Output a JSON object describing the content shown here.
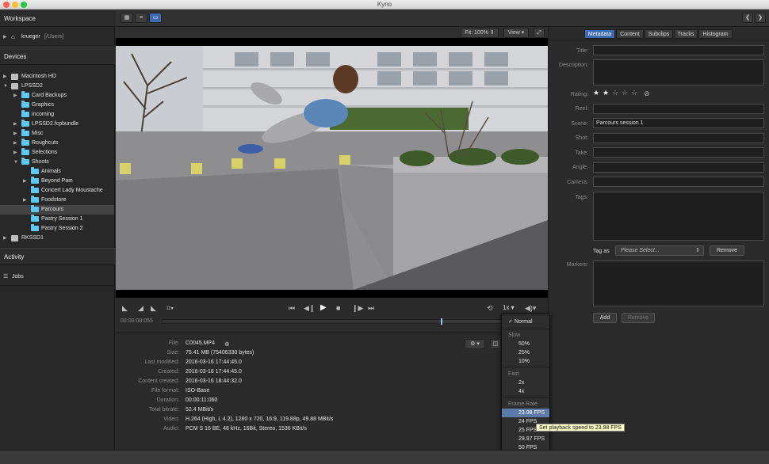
{
  "window": {
    "title": "Kyno"
  },
  "sidebar": {
    "workspace_header": "Workspace",
    "workspace_item": {
      "name": "krueger",
      "path": "[/Users]"
    },
    "devices_header": "Devices",
    "devices": [
      {
        "label": "Macintosh HD"
      },
      {
        "label": "LPSSD2"
      }
    ],
    "folders": [
      "Card Backups",
      "Graphics",
      "incoming",
      "LPSSD2.fcpbundle",
      "Misc",
      "Roughcuts",
      "Selections",
      "Shoots"
    ],
    "shoot_folders": [
      "Animals",
      "Beyond Pain",
      "Concert Lady Moustache",
      "Foodstore",
      "Parcours",
      "Pastry Session 1",
      "Pastry Session 2"
    ],
    "other_device": "RKSSD1",
    "activity_header": "Activity",
    "jobs_header": "Jobs"
  },
  "viewer": {
    "fit_label": "Fit: 100%",
    "view_label": "View",
    "timecode": "00:00:08:055",
    "speed_label": "1x",
    "progress": 0.82
  },
  "tabs": [
    "Metadata",
    "Content",
    "Subclips",
    "Tracks",
    "Histogram"
  ],
  "metadata": {
    "labels": {
      "title": "Title:",
      "description": "Description:",
      "rating": "Rating:",
      "reel": "Reel:",
      "scene": "Scene:",
      "shot": "Shot:",
      "take": "Take:",
      "angle": "Angle:",
      "camera": "Camera:",
      "tags": "Tags:",
      "markers": "Markers:"
    },
    "scene_value": "Parcours session 1",
    "rating": 2,
    "rating_max": 5,
    "tag_as_label": "Tag as",
    "tag_placeholder": "Please Select...",
    "remove_tag_label": "Remove",
    "add_marker_label": "Add",
    "remove_marker_label": "Remove"
  },
  "file_info": [
    {
      "label": "File:",
      "value": "C0045.MP4"
    },
    {
      "label": "Size:",
      "value": "75.41 MB (75406330 bytes)"
    },
    {
      "label": "Last modified:",
      "value": "2016-03-16 17:44:45.0"
    },
    {
      "label": "Created:",
      "value": "2016-03-16 17:44:45.0"
    },
    {
      "label": "Content created:",
      "value": "2016-03-16 18:44:32.0"
    },
    {
      "label": "File format:",
      "value": "ISO-Base"
    },
    {
      "label": "Duration:",
      "value": "00:00:11:060"
    },
    {
      "label": "Total bitrate:",
      "value": "52.4 MBit/s"
    },
    {
      "label": "Video:",
      "value": "H.264 (High, L 4.2), 1280 x 720, 16:9, 119.88p, 49.88 MBit/s"
    },
    {
      "label": "Audio:",
      "value": "PCM S 16 BE, 48 kHz, 16Bit, Stereo, 1536 KBit/s"
    }
  ],
  "speed_menu": {
    "normal": "Normal",
    "check": "✓",
    "slow_header": "Slow",
    "slow": [
      "50%",
      "25%",
      "10%"
    ],
    "fast_header": "Fast",
    "fast": [
      "2x",
      "4x"
    ],
    "frame_rate_header": "Frame Rate",
    "frame_rates": [
      "23.98 FPS",
      "24 FPS",
      "25 FPS",
      "29.97 FPS",
      "50 FPS",
      "59.94 FPS"
    ],
    "highlighted": "23.98 FPS",
    "tooltip": "Set playback speed to 23.98 FPS"
  }
}
